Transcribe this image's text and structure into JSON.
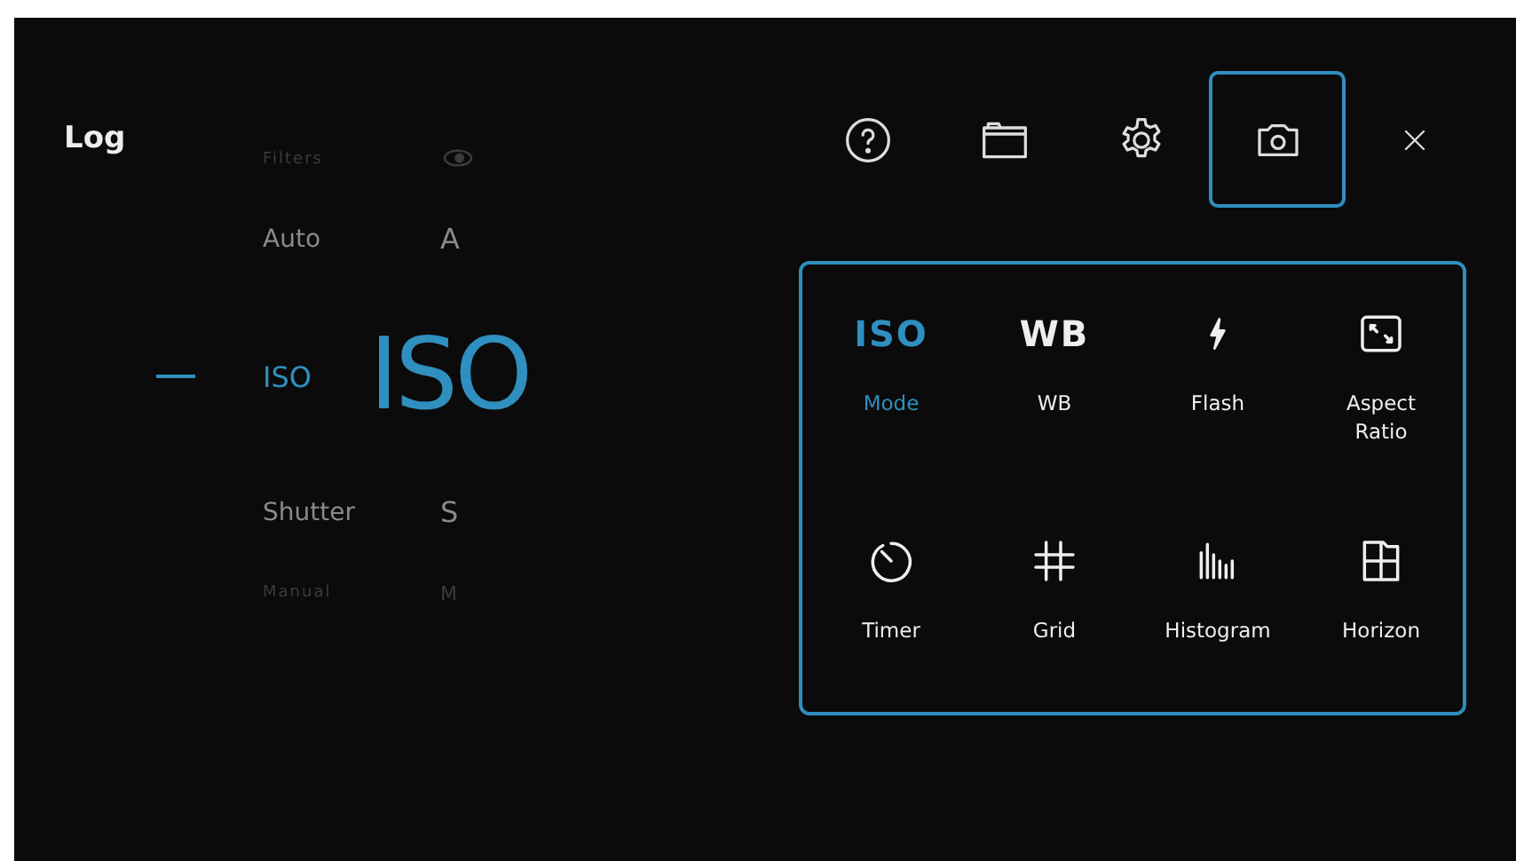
{
  "title": "Log",
  "dial": [
    {
      "label": "Filters",
      "kind": "icon",
      "dim": true,
      "selected": false
    },
    {
      "label": "Auto",
      "short": "A",
      "kind": "text",
      "dim": false,
      "selected": false
    },
    {
      "label": "ISO",
      "short": "ISO",
      "kind": "text",
      "dim": false,
      "selected": true
    },
    {
      "label": "Shutter",
      "short": "S",
      "kind": "text",
      "dim": false,
      "selected": false
    },
    {
      "label": "Manual",
      "short": "M",
      "kind": "text",
      "dim": true,
      "selected": false
    }
  ],
  "toolbar": [
    {
      "kind": "help",
      "selected": false
    },
    {
      "kind": "folder",
      "selected": false
    },
    {
      "kind": "settings",
      "selected": false
    },
    {
      "kind": "camera",
      "selected": true
    },
    {
      "kind": "close",
      "selected": false
    }
  ],
  "quick_settings": [
    {
      "label": "Mode",
      "kind": "text",
      "icon_text": "ISO",
      "selected": true
    },
    {
      "label": "WB",
      "kind": "text",
      "icon_text": "WB",
      "selected": false
    },
    {
      "label": "Flash",
      "kind": "flash",
      "selected": false
    },
    {
      "label": "Aspect Ratio",
      "kind": "aspect",
      "selected": false
    },
    {
      "label": "Timer",
      "kind": "timer",
      "selected": false
    },
    {
      "label": "Grid",
      "kind": "grid",
      "selected": false
    },
    {
      "label": "Histogram",
      "kind": "histogram",
      "selected": false
    },
    {
      "label": "Horizon",
      "kind": "horizon",
      "selected": false
    }
  ]
}
